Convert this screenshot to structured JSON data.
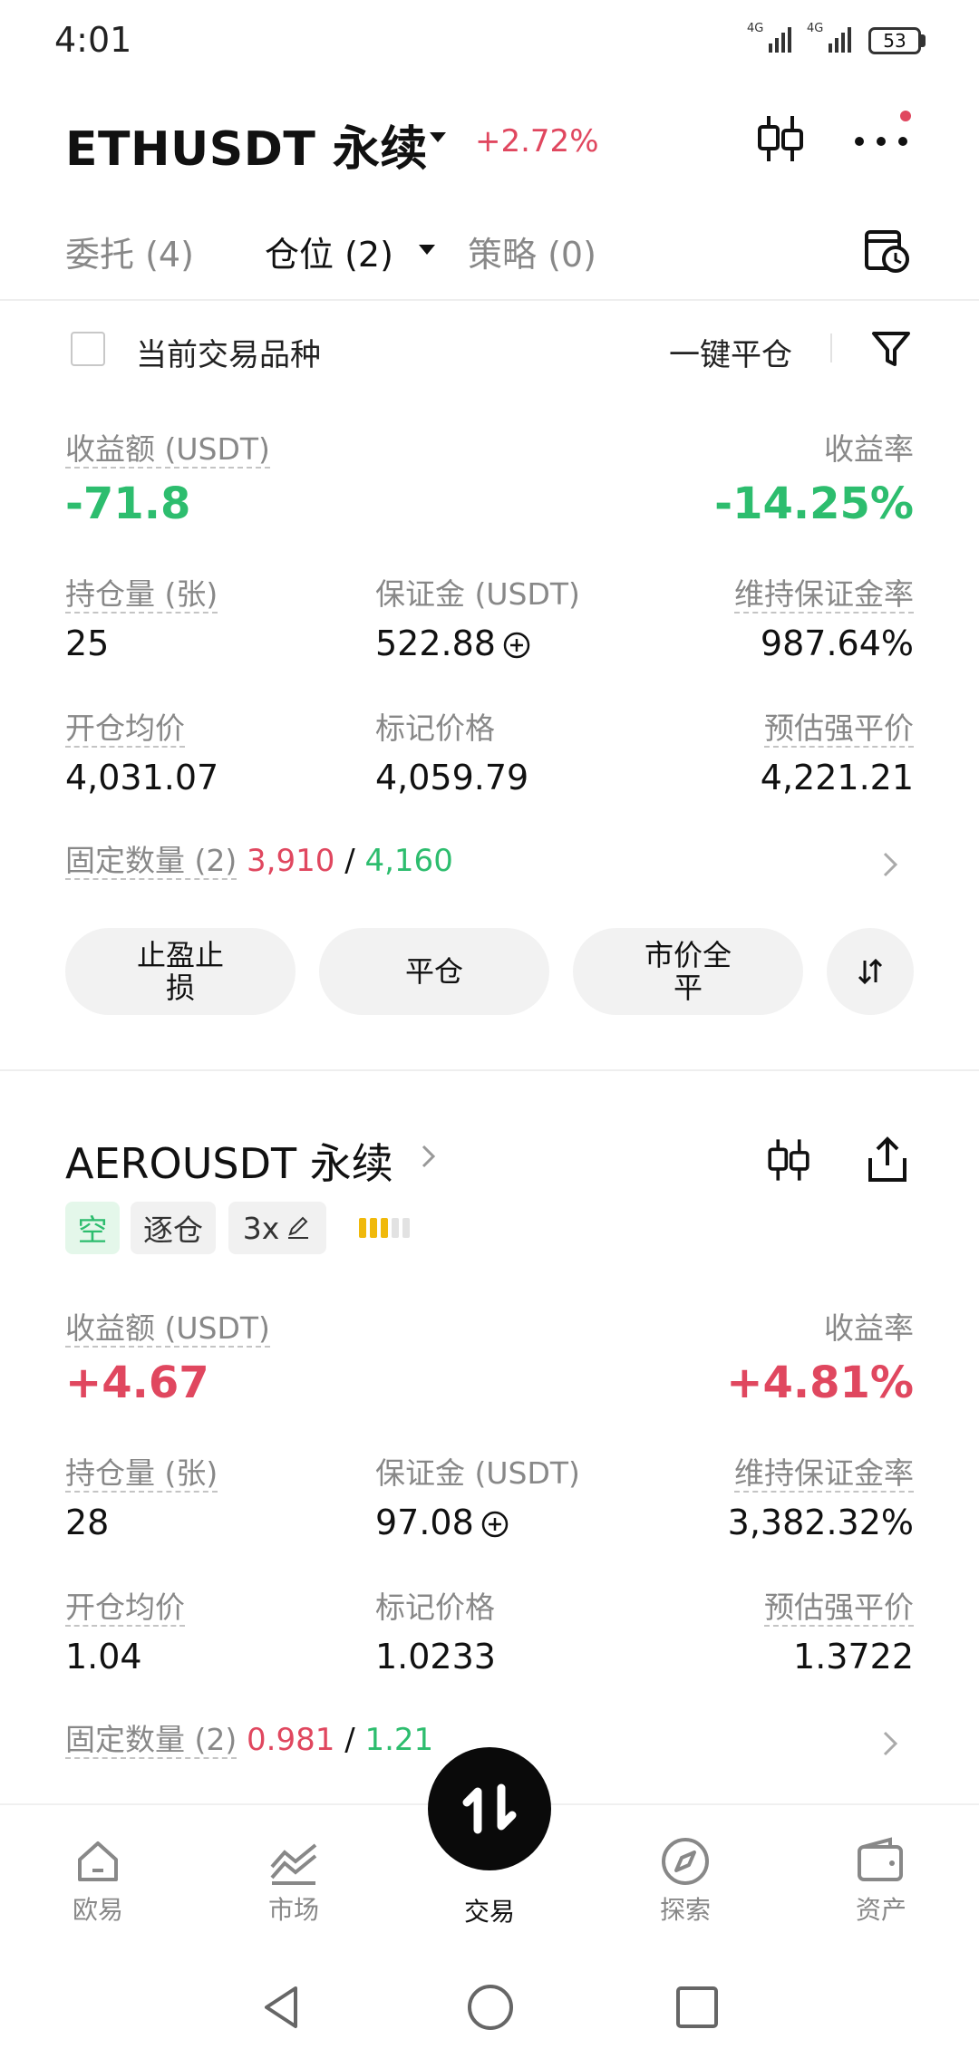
{
  "status_bar": {
    "time": "4:01",
    "signal1": "4G",
    "signal2": "4G",
    "battery": "53"
  },
  "header": {
    "title": "ETHUSDT 永续",
    "change": "+2.72%"
  },
  "tabs": [
    {
      "label": "委托 (4)"
    },
    {
      "label": "仓位 (2)"
    },
    {
      "label": "策略 (0)"
    }
  ],
  "filter": {
    "current_symbol_label": "当前交易品种",
    "close_all_label": "一键平仓"
  },
  "position1": {
    "pnl_label": "收益额 (USDT)",
    "pnl_value": "-71.8",
    "roe_label": "收益率",
    "roe_value": "-14.25%",
    "size_label": "持仓量 (张)",
    "size_value": "25",
    "margin_label": "保证金 (USDT)",
    "margin_value": "522.88",
    "mmr_label": "维持保证金率",
    "mmr_value": "987.64%",
    "entry_label": "开仓均价",
    "entry_value": "4,031.07",
    "mark_label": "标记价格",
    "mark_value": "4,059.79",
    "liq_label": "预估强平价",
    "liq_value": "4,221.21",
    "fixed_label": "固定数量 (2)",
    "fixed_tp": "3,910",
    "fixed_sep": "/",
    "fixed_sl": "4,160",
    "btn_tpsl_1": "止盈止",
    "btn_tpsl_2": "损",
    "btn_close": "平仓",
    "btn_market_1": "市价全",
    "btn_market_2": "平"
  },
  "position2": {
    "title": "AEROUSDT 永续",
    "tag_side": "空",
    "tag_mode": "逐仓",
    "tag_leverage": "3x",
    "pnl_label": "收益额 (USDT)",
    "pnl_value": "+4.67",
    "roe_label": "收益率",
    "roe_value": "+4.81%",
    "size_label": "持仓量 (张)",
    "size_value": "28",
    "margin_label": "保证金 (USDT)",
    "margin_value": "97.08",
    "mmr_label": "维持保证金率",
    "mmr_value": "3,382.32%",
    "entry_label": "开仓均价",
    "entry_value": "1.04",
    "mark_label": "标记价格",
    "mark_value": "1.0233",
    "liq_label": "预估强平价",
    "liq_value": "1.3722",
    "fixed_label": "固定数量 (2)",
    "fixed_tp": "0.981",
    "fixed_sep": "/",
    "fixed_sl": "1.21"
  },
  "bottom_nav": [
    {
      "label": "欧易",
      "icon": "home-icon"
    },
    {
      "label": "市场",
      "icon": "chart-icon"
    },
    {
      "label": "交易",
      "icon": "swap-icon"
    },
    {
      "label": "探索",
      "icon": "compass-icon"
    },
    {
      "label": "资产",
      "icon": "wallet-icon"
    }
  ],
  "colors": {
    "green": "#2dbd6e",
    "red": "#e0475f",
    "accent_bg": "#f2f2f2"
  }
}
